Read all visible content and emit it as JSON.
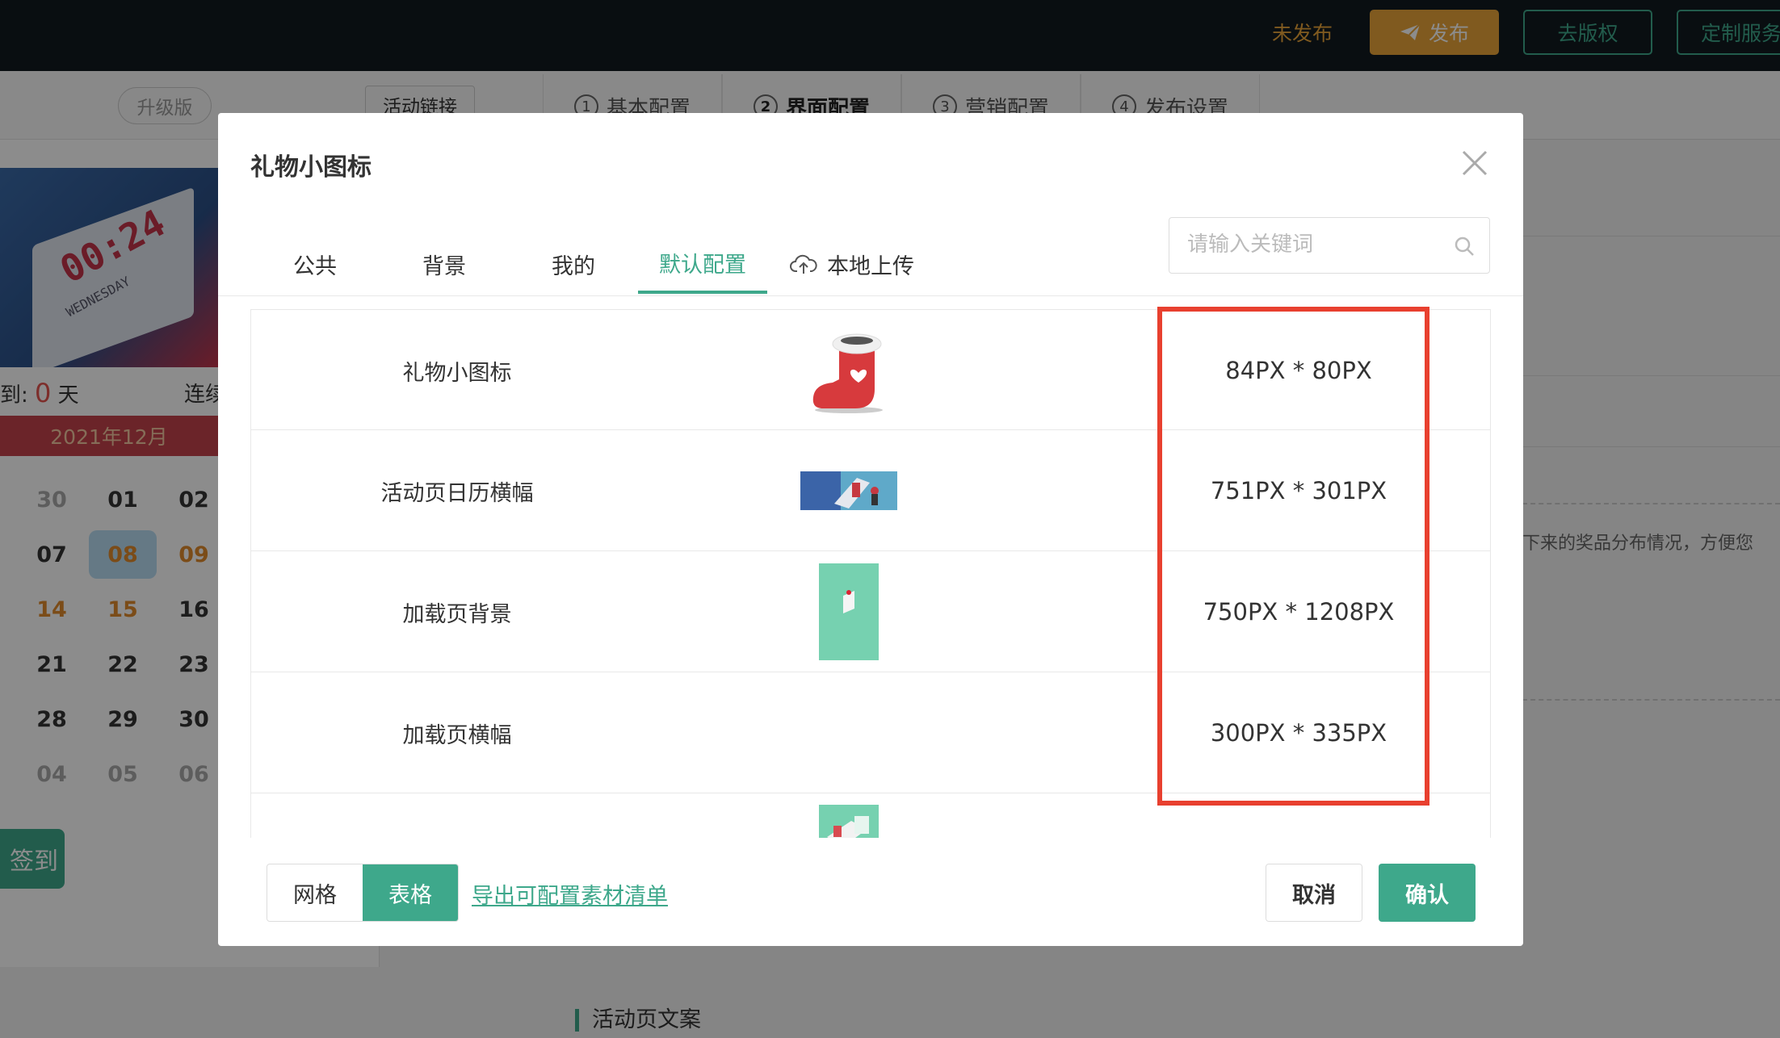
{
  "topbar": {
    "status": "未发布",
    "publish_label": "发布",
    "btn_copyright": "去版权",
    "btn_custom": "定制服务"
  },
  "subbar": {
    "upgrade_pill": "升级版",
    "activity_link": "活动链接",
    "steps": [
      {
        "num": "1",
        "label": "基本配置"
      },
      {
        "num": "2",
        "label": "界面配置"
      },
      {
        "num": "3",
        "label": "营销配置"
      },
      {
        "num": "4",
        "label": "发布设置"
      }
    ]
  },
  "preview": {
    "poster_time": "00:24",
    "poster_day": "WEDNESDAY",
    "signed_prefix": "到:",
    "signed_count": "0",
    "signed_unit": "天",
    "streak_label": "连续",
    "month": "2021年12月",
    "days": [
      "30",
      "01",
      "02",
      "07",
      "08",
      "09",
      "14",
      "15",
      "16",
      "21",
      "22",
      "23",
      "28",
      "29",
      "30",
      "04",
      "05",
      "06"
    ],
    "sign_button": "签到"
  },
  "background_right": {
    "hint_text": "下来的奖品分布情况，方便您",
    "section_title": "活动页文案"
  },
  "modal": {
    "title": "礼物小图标",
    "tabs": [
      "公共",
      "背景",
      "我的",
      "默认配置"
    ],
    "upload_tab": "本地上传",
    "search_placeholder": "请输入关键词",
    "rows": [
      {
        "name": "礼物小图标",
        "size": "84PX * 80PX"
      },
      {
        "name": "活动页日历横幅",
        "size": "751PX * 301PX"
      },
      {
        "name": "加载页背景",
        "size": "750PX * 1208PX"
      },
      {
        "name": "加载页横幅",
        "size": "300PX * 335PX"
      },
      {
        "name": "",
        "size": ""
      }
    ],
    "view_grid": "网格",
    "view_table": "表格",
    "export_link": "导出可配置素材清单",
    "cancel": "取消",
    "confirm": "确认"
  },
  "colors": {
    "accent": "#3ea88b",
    "warning": "#e9a43a",
    "highlight_box": "#e8402f"
  }
}
